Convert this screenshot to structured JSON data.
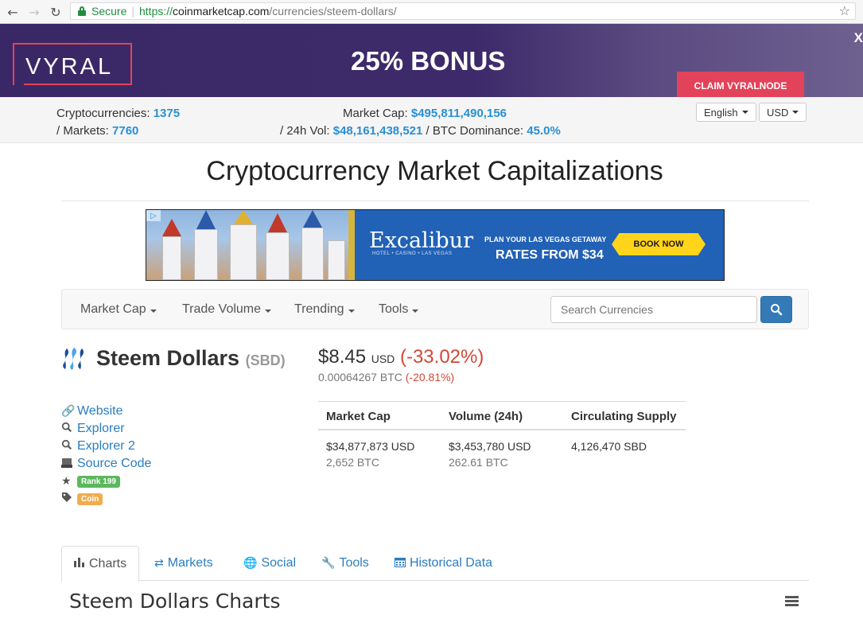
{
  "browser": {
    "secure_label": "Secure",
    "url_scheme": "https://",
    "url_host": "coinmarketcap.com",
    "url_path": "/currencies/steem-dollars/"
  },
  "ad_top": {
    "logo": "VYRAL",
    "headline": "25% BONUS",
    "cta": "CLAIM VYRALNODE",
    "close": "X"
  },
  "stats": {
    "crypto_label": "Cryptocurrencies:",
    "crypto_value": "1375",
    "markets_label": "/ Markets:",
    "markets_value": "7760",
    "mcap_label": "Market Cap:",
    "mcap_value": "$495,811,490,156",
    "vol_label": "/ 24h Vol:",
    "vol_value": "$48,161,438,521",
    "dom_label": "/ BTC Dominance:",
    "dom_value": "45.0%",
    "language": "English",
    "currency": "USD"
  },
  "page_title": "Cryptocurrency Market Capitalizations",
  "ad_mid": {
    "brand": "Excalibur",
    "brand_sub": "HOTEL • CASINO • LAS VEGAS",
    "line1": "PLAN YOUR LAS VEGAS GETAWAY",
    "line2": "RATES FROM $34",
    "cta": "BOOK NOW"
  },
  "navbar": {
    "items": [
      "Market Cap",
      "Trade Volume",
      "Trending",
      "Tools"
    ],
    "search_placeholder": "Search Currencies"
  },
  "coin": {
    "name": "Steem Dollars",
    "symbol": "(SBD)",
    "price": "$8.45",
    "price_unit": "USD",
    "price_change": "(-33.02%)",
    "btc_price": "0.00064267 BTC",
    "btc_change": "(-20.81%)"
  },
  "links": {
    "website": "Website",
    "explorer": "Explorer",
    "explorer2": "Explorer 2",
    "source": "Source Code",
    "rank": "Rank 199",
    "type": "Coin"
  },
  "table": {
    "headers": [
      "Market Cap",
      "Volume (24h)",
      "Circulating Supply"
    ],
    "mcap_usd": "$34,877,873 USD",
    "mcap_btc": "2,652 BTC",
    "vol_usd": "$3,453,780 USD",
    "vol_btc": "262.61 BTC",
    "supply": "4,126,470 SBD"
  },
  "tabs": [
    "Charts",
    "Markets",
    "Social",
    "Tools",
    "Historical Data"
  ],
  "charts_title": "Steem Dollars Charts",
  "colors": {
    "link": "#2a7dc1",
    "stat_blue": "#2a8fd4",
    "negative": "#d14836",
    "rank_badge": "#5cb85c",
    "coin_badge": "#f0ad4e",
    "ad_accent": "#e2435a"
  }
}
